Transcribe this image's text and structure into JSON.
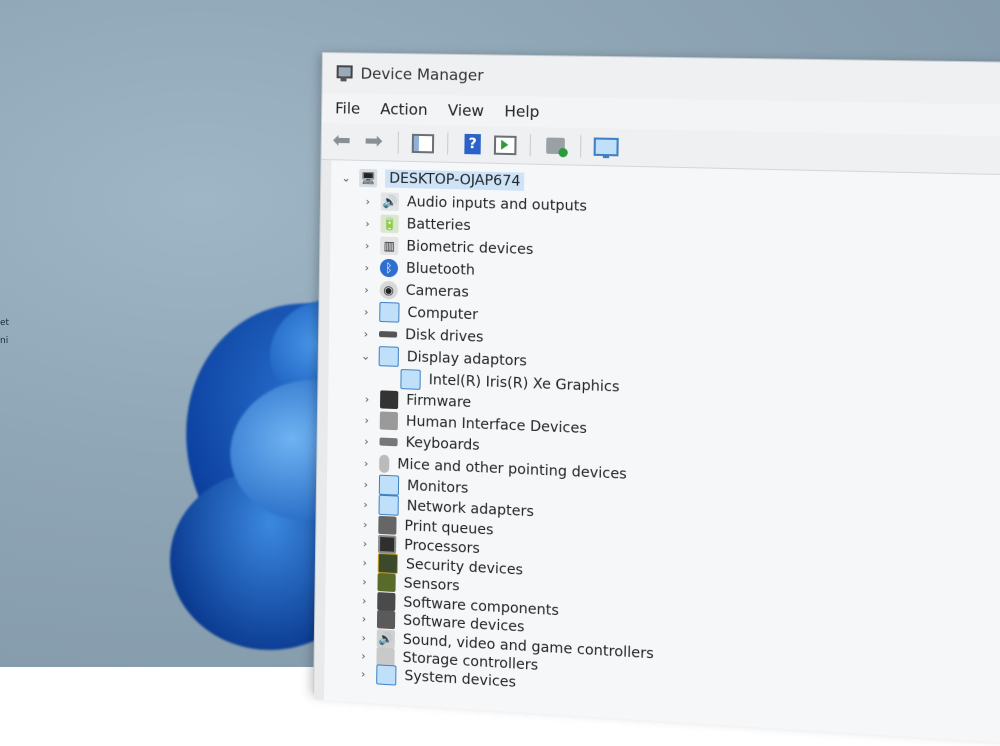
{
  "window": {
    "title": "Device Manager"
  },
  "menu": [
    "File",
    "Action",
    "View",
    "Help"
  ],
  "toolbar": {
    "buttons": [
      "back-icon",
      "forward-icon",
      "properties-icon",
      "help-icon",
      "update-driver-icon",
      "scan-hardware-icon",
      "monitor-icon"
    ]
  },
  "tree": {
    "root": "DESKTOP-OJAP674",
    "items": [
      {
        "label": "Audio inputs and outputs",
        "icon": "speaker-icon",
        "expanded": false
      },
      {
        "label": "Batteries",
        "icon": "battery-icon",
        "expanded": false
      },
      {
        "label": "Biometric devices",
        "icon": "fingerprint-icon",
        "expanded": false
      },
      {
        "label": "Bluetooth",
        "icon": "bluetooth-icon",
        "expanded": false
      },
      {
        "label": "Cameras",
        "icon": "camera-icon",
        "expanded": false
      },
      {
        "label": "Computer",
        "icon": "computer-icon",
        "expanded": false
      },
      {
        "label": "Disk drives",
        "icon": "disk-drive-icon",
        "expanded": false
      },
      {
        "label": "Display adaptors",
        "icon": "display-adapter-icon",
        "expanded": true
      },
      {
        "label": "Intel(R) Iris(R) Xe Graphics",
        "icon": "display-adapter-icon",
        "child": true
      },
      {
        "label": "Firmware",
        "icon": "firmware-icon",
        "expanded": false
      },
      {
        "label": "Human Interface Devices",
        "icon": "hid-icon",
        "expanded": false
      },
      {
        "label": "Keyboards",
        "icon": "keyboard-icon",
        "expanded": false
      },
      {
        "label": "Mice and other pointing devices",
        "icon": "mouse-icon",
        "expanded": false
      },
      {
        "label": "Monitors",
        "icon": "monitor-icon",
        "expanded": false
      },
      {
        "label": "Network adapters",
        "icon": "network-adapter-icon",
        "expanded": false
      },
      {
        "label": "Print queues",
        "icon": "printer-icon",
        "expanded": false
      },
      {
        "label": "Processors",
        "icon": "processor-icon",
        "expanded": false
      },
      {
        "label": "Security devices",
        "icon": "security-device-icon",
        "expanded": false
      },
      {
        "label": "Sensors",
        "icon": "sensor-icon",
        "expanded": false
      },
      {
        "label": "Software components",
        "icon": "software-component-icon",
        "expanded": false
      },
      {
        "label": "Software devices",
        "icon": "software-device-icon",
        "expanded": false
      },
      {
        "label": "Sound, video and game controllers",
        "icon": "sound-icon",
        "expanded": false
      },
      {
        "label": "Storage controllers",
        "icon": "storage-controller-icon",
        "expanded": false
      },
      {
        "label": "System devices",
        "icon": "system-device-icon",
        "expanded": false
      }
    ]
  },
  "desktop": {
    "side_labels": [
      "et",
      "ni"
    ]
  }
}
